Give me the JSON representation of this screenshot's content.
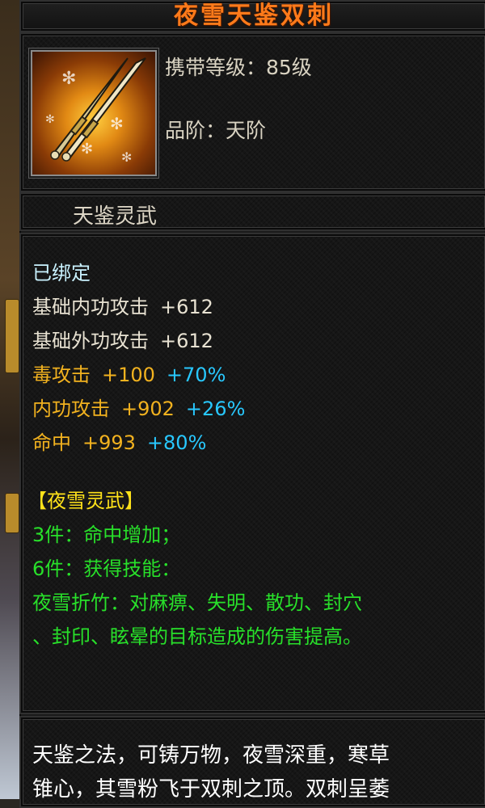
{
  "item": {
    "name": "夜雪天鉴双刺",
    "carry_level": "携带等级：85级",
    "grade": "品阶：天阶",
    "icon": "twin-daggers-icon",
    "category": "天鉴灵武"
  },
  "stats": {
    "bound": "已绑定",
    "base_inner": {
      "label": "基础内功攻击",
      "value": "+612"
    },
    "base_outer": {
      "label": "基础外功攻击",
      "value": "+612"
    },
    "poison": {
      "label": "毒攻击",
      "value": "+100",
      "bonus": "+70%"
    },
    "inner": {
      "label": "内功攻击",
      "value": "+902",
      "bonus": "+26%"
    },
    "hit": {
      "label": "命中",
      "value": "+993",
      "bonus": "+80%"
    }
  },
  "set": {
    "title": "【夜雪灵武】",
    "piece3": "3件：命中增加；",
    "piece6": "6件：获得技能：",
    "skill_line1": "夜雪折竹：对麻痹、失明、散功、封穴",
    "skill_line2": "、封印、眩晕的目标造成的伤害提高。"
  },
  "description": {
    "line1": "天鉴之法，可铸万物，夜雪深重，寒草",
    "line2": "锥心，其雪粉飞于双刺之顶。双刺呈萎"
  },
  "colors": {
    "title": "#ff7a1a",
    "stat_white": "#e8e2d2",
    "stat_gold": "#f2b21f",
    "bonus_blue": "#28c8ff",
    "set_yellow": "#ffe21a",
    "set_green": "#28e02a"
  }
}
